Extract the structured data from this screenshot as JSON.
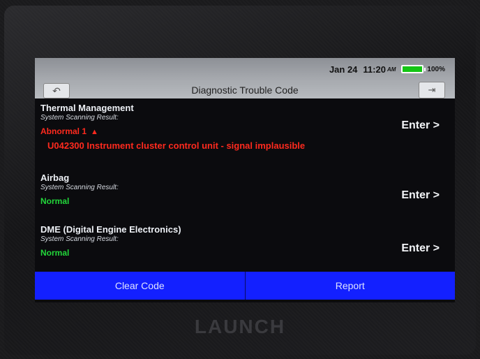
{
  "status_bar": {
    "date": "Jan 24",
    "time": "11:20",
    "ampm": "AM",
    "battery_pct": "100%"
  },
  "title_bar": {
    "title": "Diagnostic Trouble Code",
    "back_icon": "back-arrow-icon",
    "exit_icon": "exit-icon"
  },
  "systems": [
    {
      "name": "Thermal Management",
      "subtitle": "System Scanning Result:",
      "status": "Abnormal 1",
      "status_color": "#ff2a1e",
      "dtc": "U042300 Instrument cluster control unit - signal implausible",
      "enter": "Enter >"
    },
    {
      "name": "Airbag",
      "subtitle": "System Scanning Result:",
      "status": "Normal",
      "status_color": "#22d63a",
      "enter": "Enter >"
    },
    {
      "name": "DME (Digital Engine Electronics)",
      "subtitle": "System Scanning Result:",
      "status": "Normal",
      "status_color": "#22d63a",
      "enter": "Enter >"
    }
  ],
  "footer": {
    "clear_code": "Clear Code",
    "report": "Report"
  },
  "brand": "LAUNCH",
  "colors": {
    "footer_button": "#1320ff",
    "abnormal": "#ff2a1e",
    "normal": "#22d63a",
    "battery": "#14c514"
  }
}
